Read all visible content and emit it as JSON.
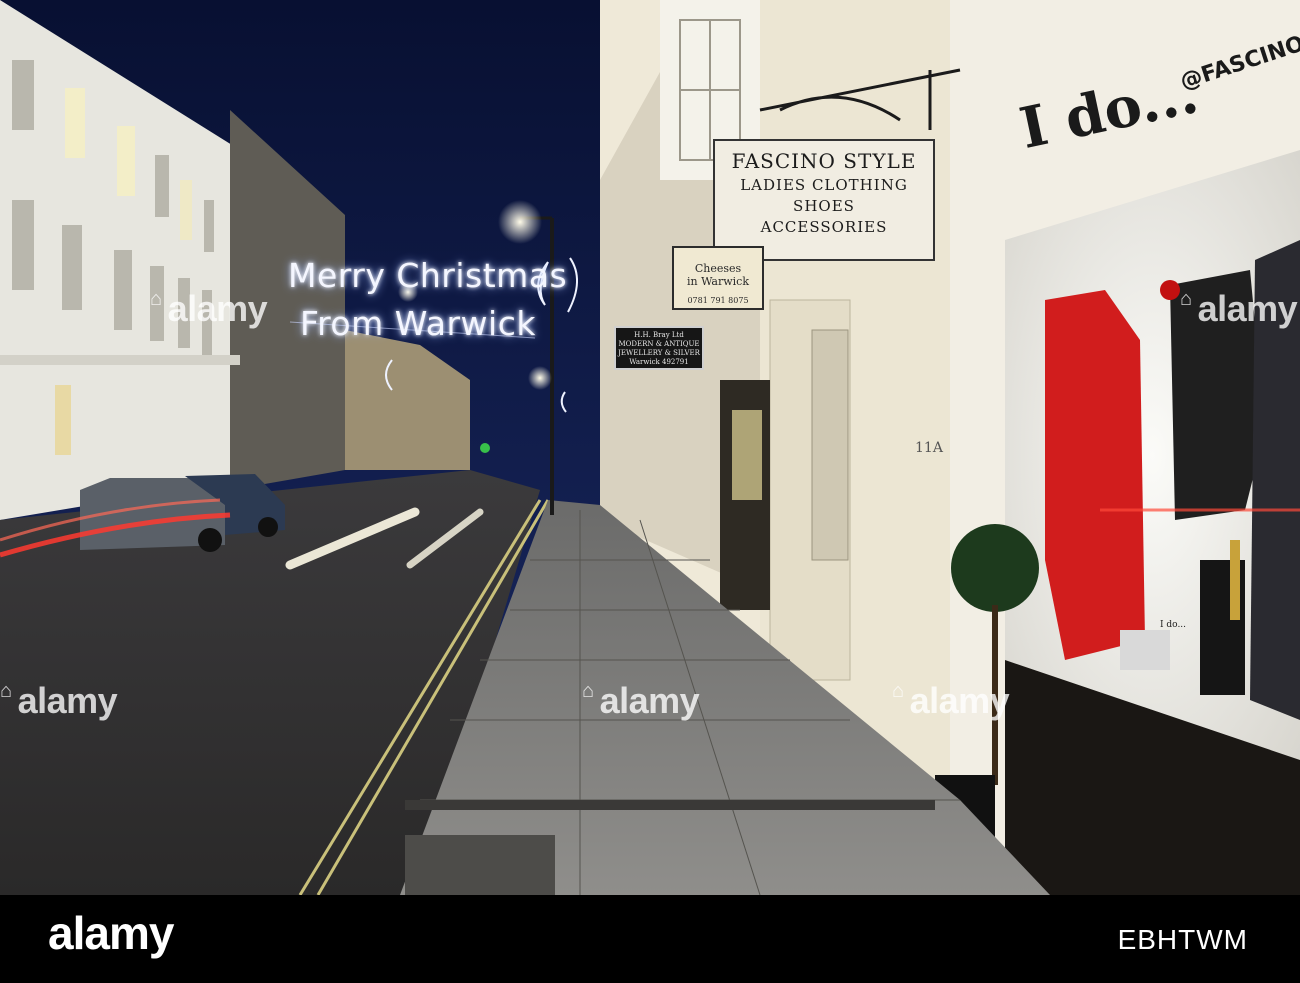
{
  "scene": {
    "description_icon": "street-scene-photo",
    "christmas_lights": {
      "line1": "Merry Christmas",
      "line2": "From Warwick"
    },
    "shop_sign": {
      "line1": "FASCINO STYLE",
      "line2": "LADIES CLOTHING",
      "line3": "SHOES",
      "line4": "ACCESSORIES"
    },
    "cheese_sign": {
      "line1": "Cheeses",
      "line2": "in Warwick",
      "phone": "0781 791 8075"
    },
    "jewellery_sign": {
      "line1": "H.H. Bray Ltd",
      "line2": "MODERN & ANTIQUE",
      "line3": "JEWELLERY & SILVER",
      "line4": "Warwick 492791"
    },
    "shop_name": {
      "main": "I do...",
      "handle": "@FASCINO"
    },
    "door_number": "11A",
    "window_tag": "I do...",
    "colors": {
      "sky": "#0b1330",
      "dress_red": "#d11d1d",
      "street_light": "#fff6d8"
    }
  },
  "watermarks": [
    "alamy",
    "alamy",
    "alamy",
    "alamy",
    "alamy"
  ],
  "footer": {
    "brand": "alamy",
    "image_id": "EBHTWM"
  }
}
